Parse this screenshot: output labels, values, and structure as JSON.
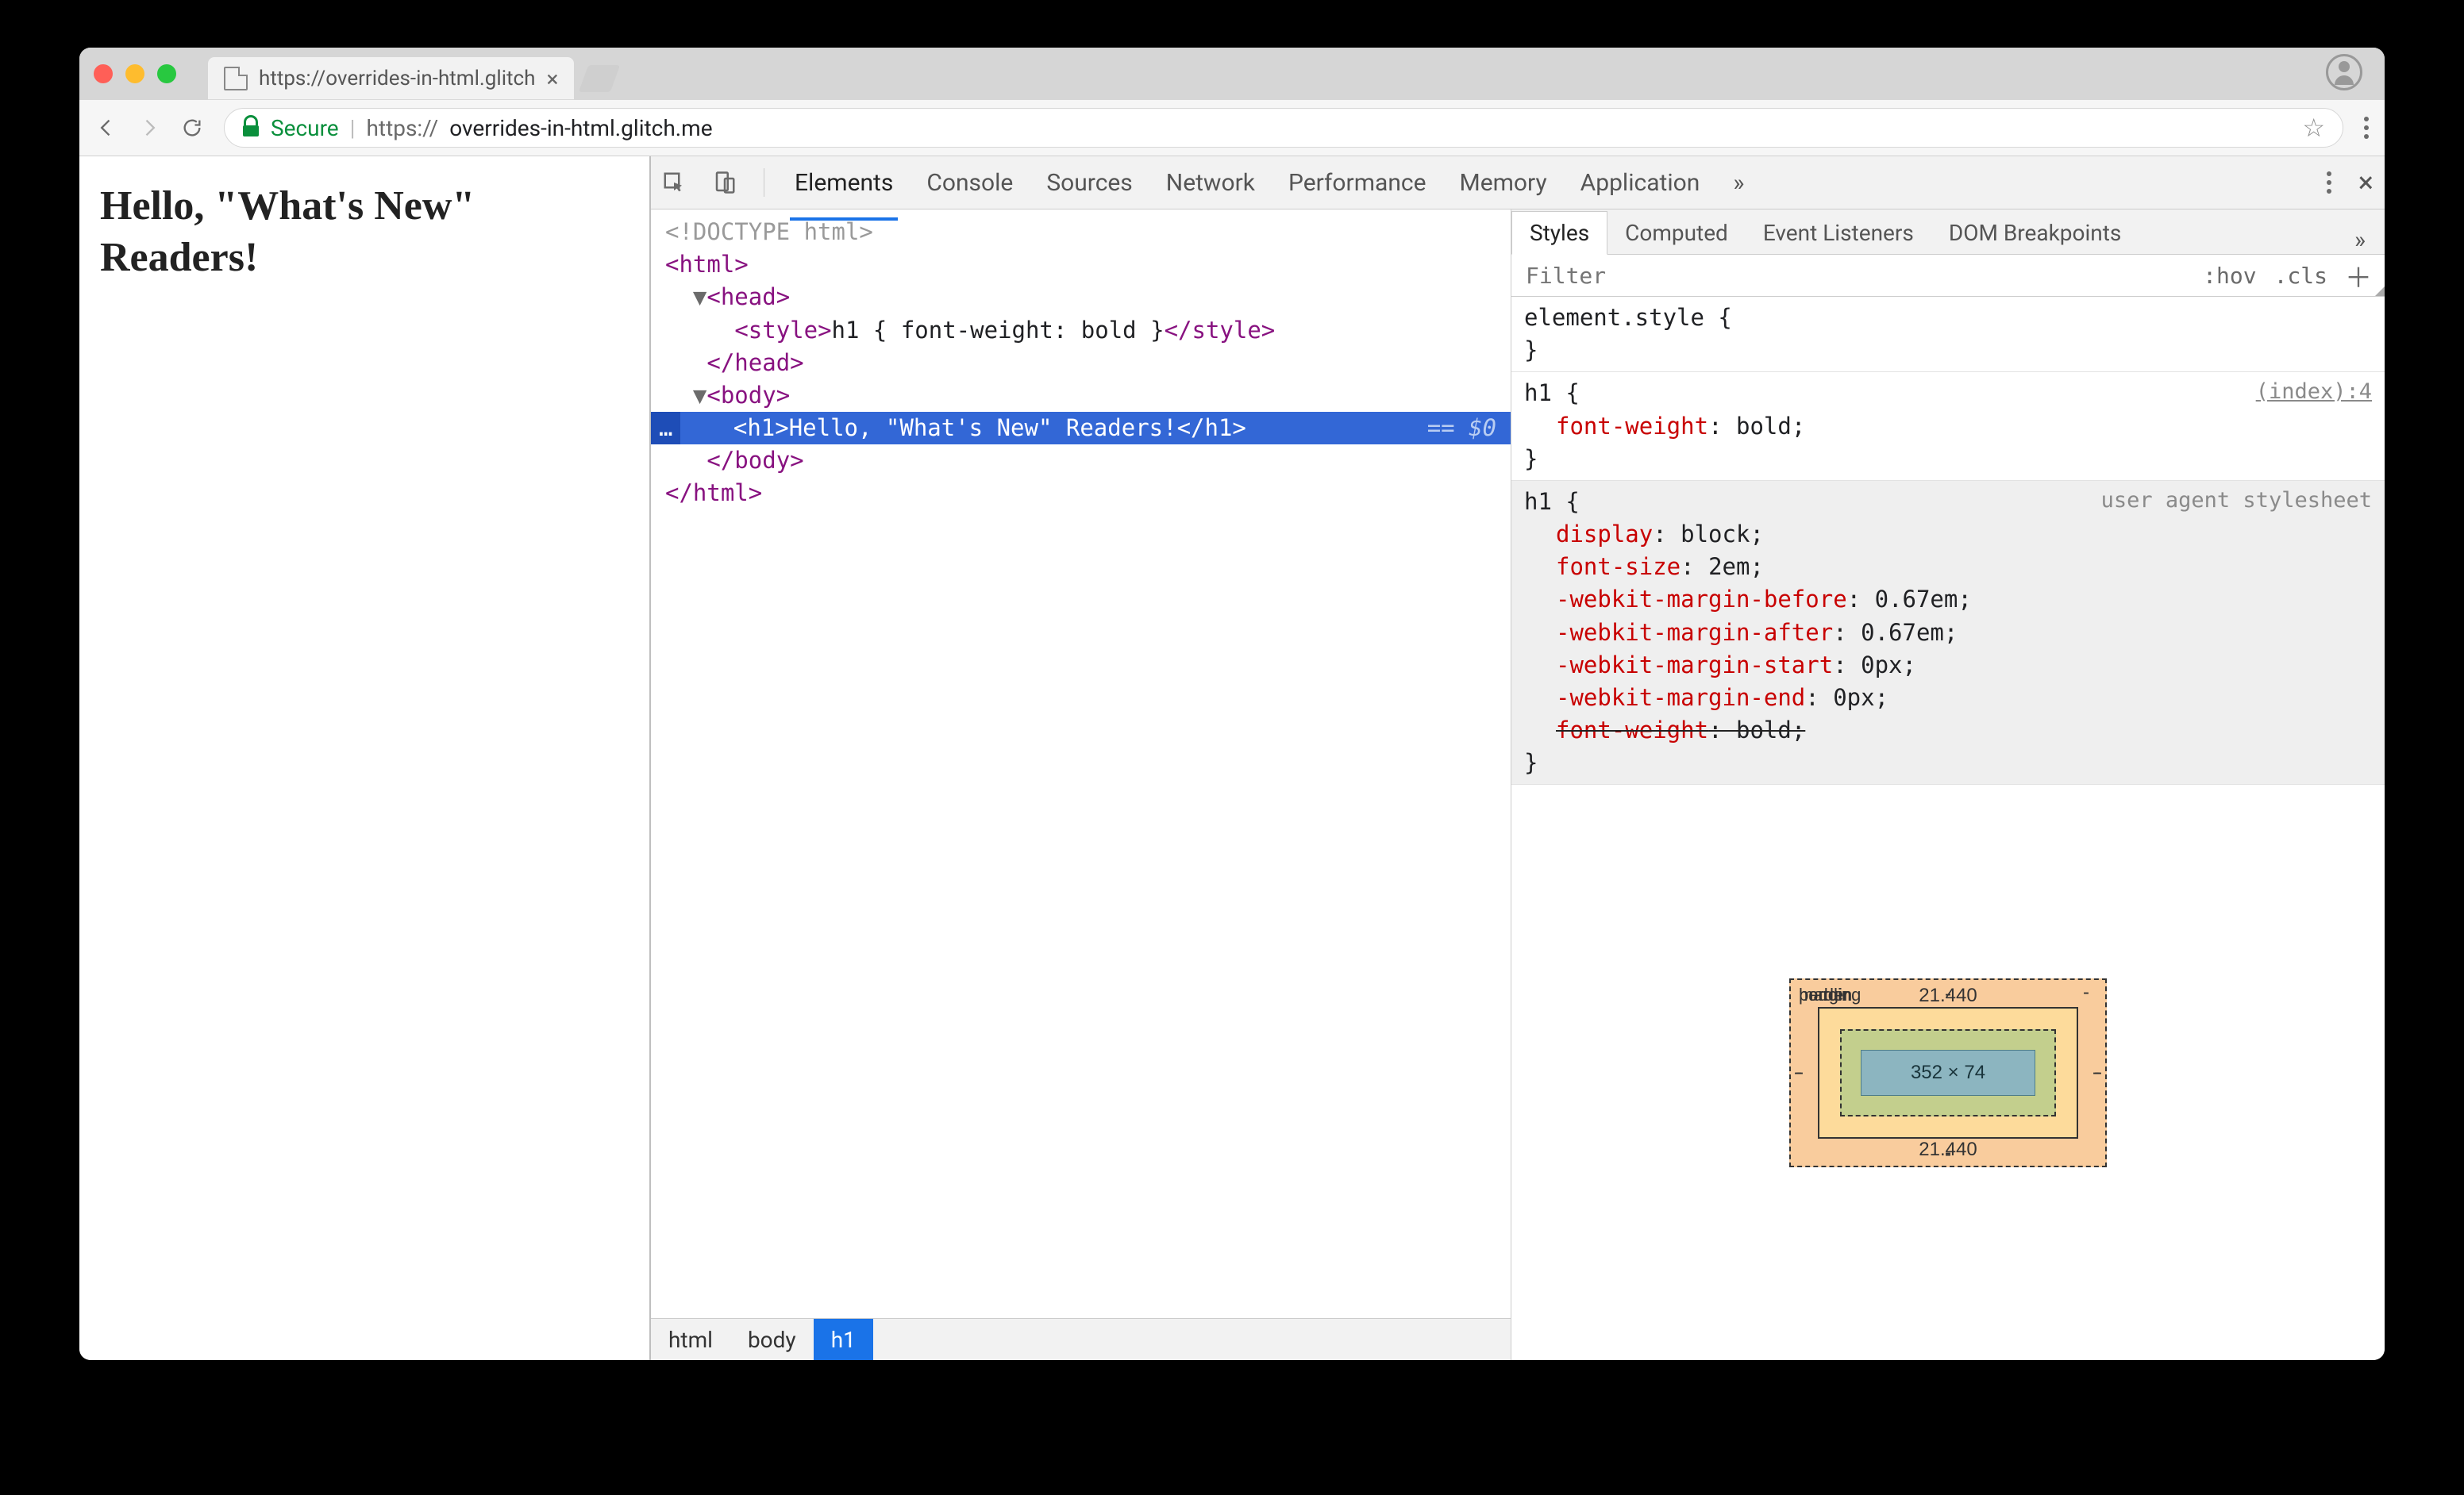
{
  "browser": {
    "tab_title": "https://overrides-in-html.glitch",
    "url_secure_label": "Secure",
    "url_scheme": "https://",
    "url_rest": "overrides-in-html.glitch.me"
  },
  "page": {
    "heading": "Hello, \"What's New\" Readers!"
  },
  "devtools": {
    "tabs": [
      "Elements",
      "Console",
      "Sources",
      "Network",
      "Performance",
      "Memory",
      "Application"
    ],
    "active_tab": "Elements",
    "styles_tabs": [
      "Styles",
      "Computed",
      "Event Listeners",
      "DOM Breakpoints"
    ],
    "styles_active": "Styles",
    "filter_placeholder": "Filter",
    "hov_label": ":hov",
    "cls_label": ".cls",
    "breadcrumbs": [
      "html",
      "body",
      "h1"
    ],
    "breadcrumbs_active": "h1"
  },
  "tree": {
    "l1": "<!DOCTYPE html>",
    "l2": "<html>",
    "l3_open": "<head>",
    "l4_open": "<style>",
    "l4_text": "h1 { font-weight: bold }",
    "l4_close": "</style>",
    "l5": "</head>",
    "l6": "<body>",
    "l7_open": "<h1>",
    "l7_text": "Hello, \"What's New\" Readers!",
    "l7_close": "</h1>",
    "l7_meta": "== $0",
    "l8": "</body>",
    "l9": "</html>"
  },
  "rule1": {
    "selector": "element.style {",
    "close": "}"
  },
  "rule2": {
    "selector": "h1 {",
    "source": "(index):4",
    "p1": "font-weight",
    "v1": "bold;",
    "close": "}"
  },
  "rule3": {
    "selector": "h1 {",
    "label": "user agent stylesheet",
    "p1": "display",
    "v1": "block;",
    "p2": "font-size",
    "v2": "2em;",
    "p3": "-webkit-margin-before",
    "v3": "0.67em;",
    "p4": "-webkit-margin-after",
    "v4": "0.67em;",
    "p5": "-webkit-margin-start",
    "v5": "0px;",
    "p6": "-webkit-margin-end",
    "v6": "0px;",
    "p7": "font-weight",
    "v7": "bold;",
    "close": "}"
  },
  "boxmodel": {
    "margin_label": "margin",
    "border_label": "border",
    "padding_label": "padding",
    "margin_top": "21.440",
    "margin_bottom": "21.440",
    "side_dash": "-",
    "content": "352 × 74"
  }
}
